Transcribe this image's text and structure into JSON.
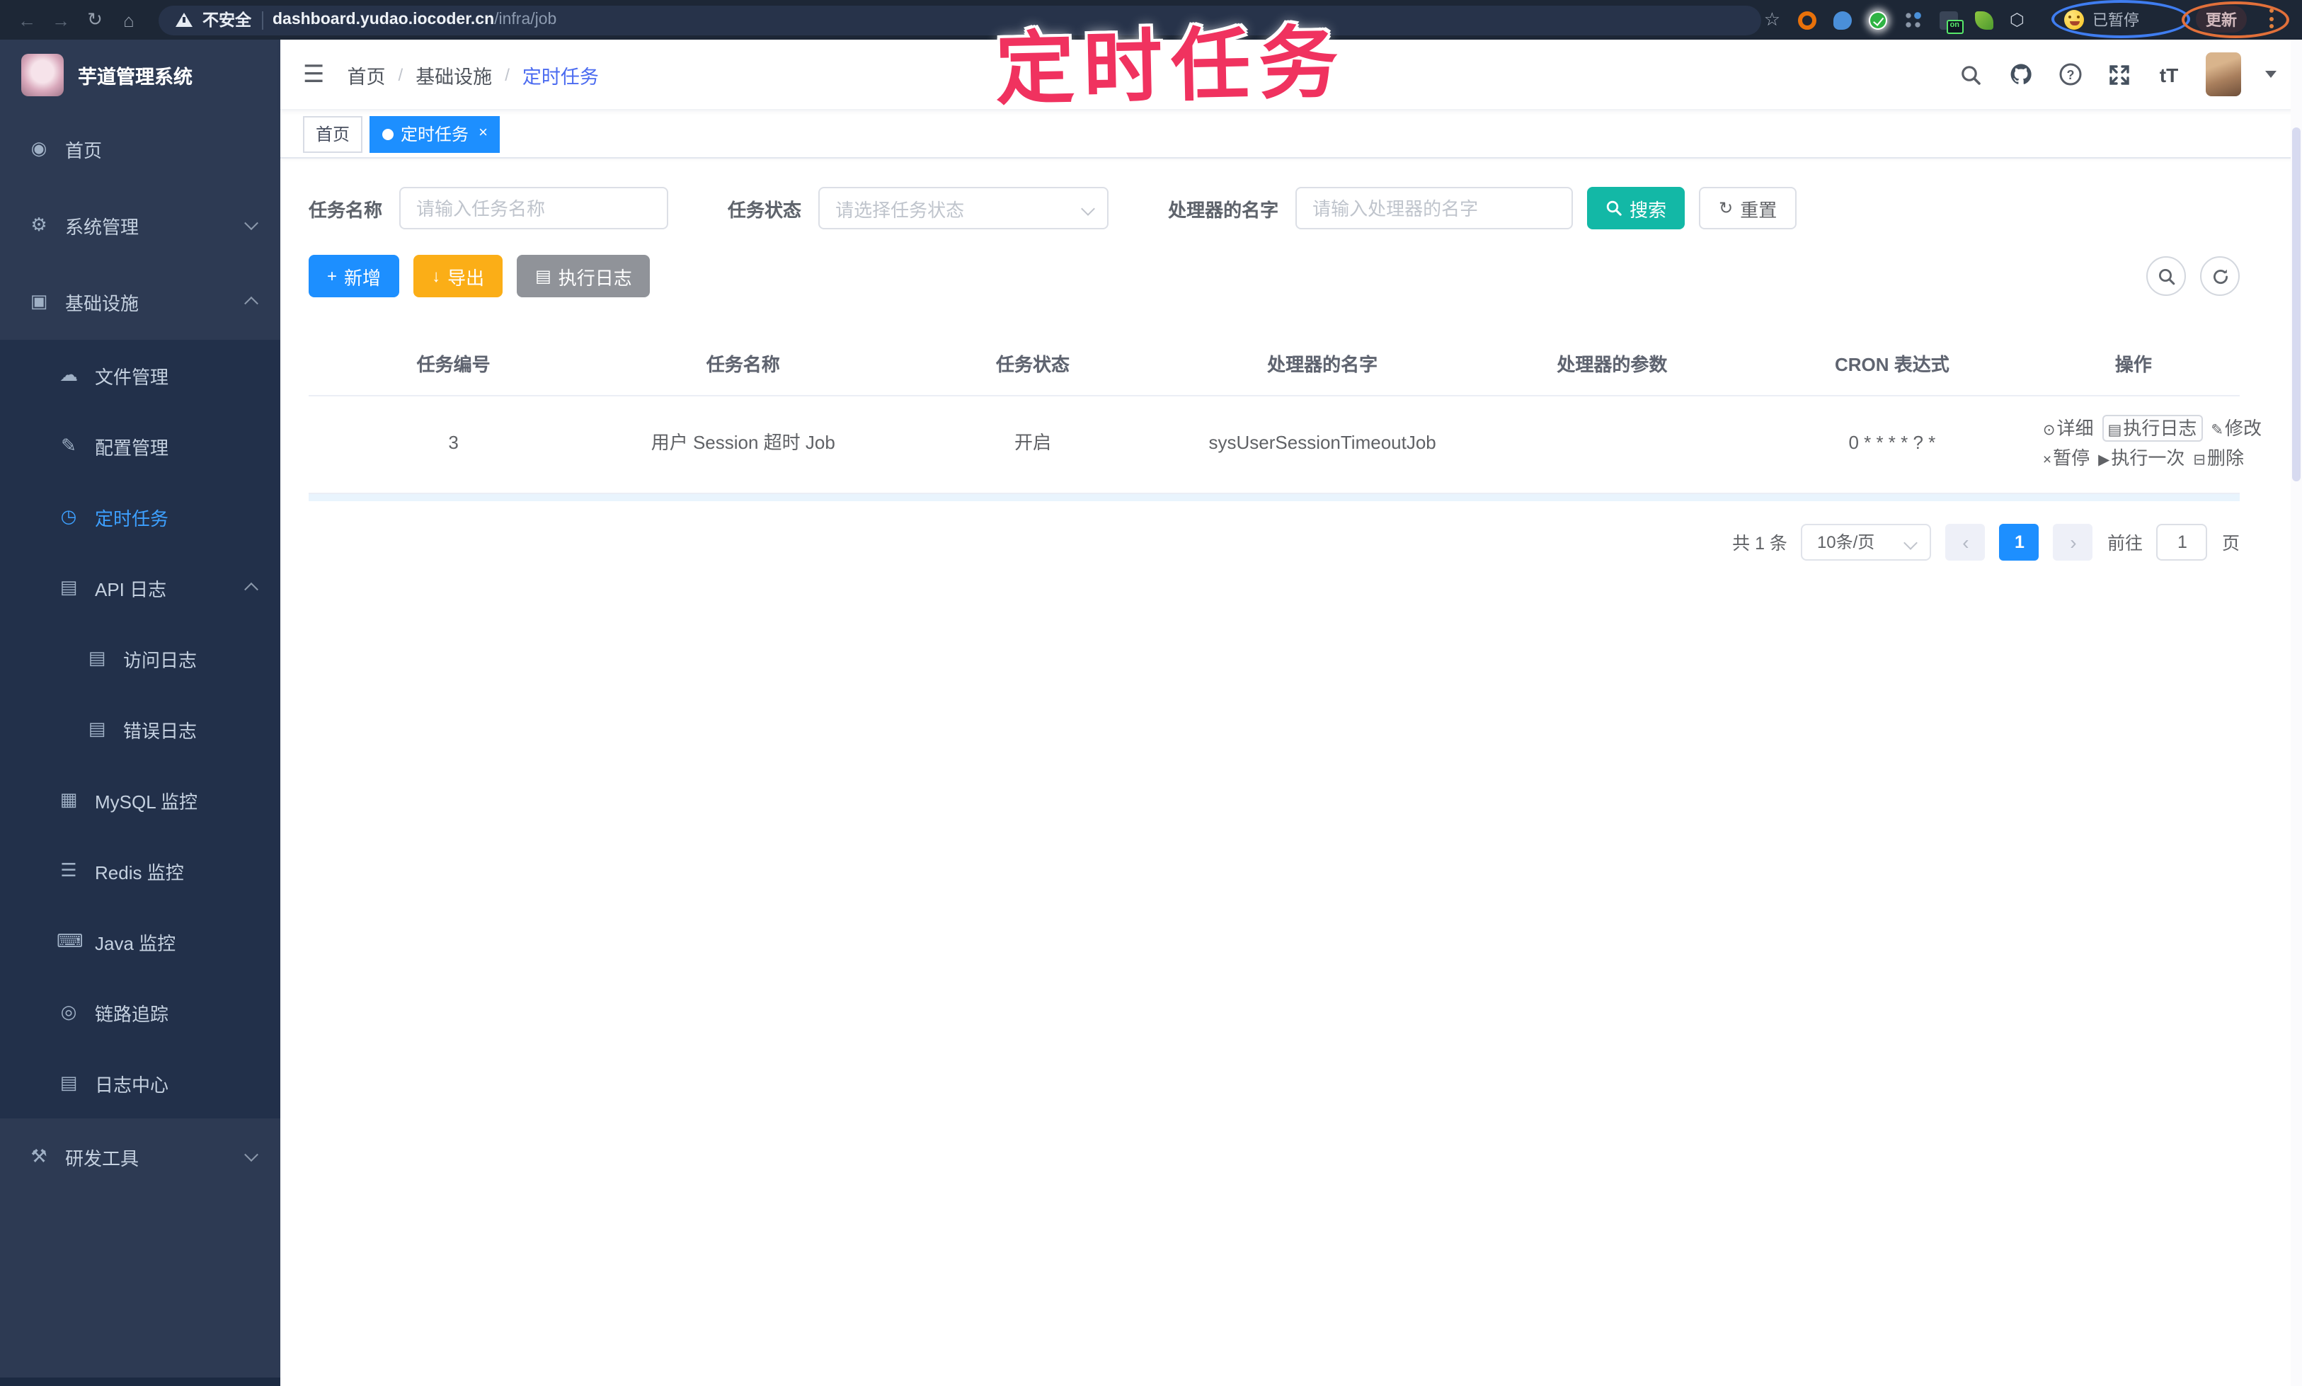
{
  "browser": {
    "back_icon": "←",
    "forward_icon": "→",
    "reload_icon": "↻",
    "home_icon": "⌂",
    "security_warning": "不安全",
    "url_host": "dashboard.yudao.iocoder.cn",
    "url_path": "/infra/job",
    "ext_on_badge": "on",
    "paused_badge": "已暂停",
    "update_button": "更新"
  },
  "annotation": {
    "title": "定时任务"
  },
  "sidebar": {
    "title": "芋道管理系统",
    "items": [
      {
        "icon": "◉",
        "label": "首页"
      },
      {
        "icon": "⚙",
        "label": "系统管理"
      },
      {
        "icon": "▣",
        "label": "基础设施"
      },
      {
        "icon": "☁",
        "label": "文件管理"
      },
      {
        "icon": "✎",
        "label": "配置管理"
      },
      {
        "icon": "◷",
        "label": "定时任务"
      },
      {
        "icon": "▤",
        "label": "API 日志"
      },
      {
        "icon": "▤",
        "label": "访问日志"
      },
      {
        "icon": "▤",
        "label": "错误日志"
      },
      {
        "icon": "▦",
        "label": "MySQL 监控"
      },
      {
        "icon": "☰",
        "label": "Redis 监控"
      },
      {
        "icon": "⌨",
        "label": "Java 监控"
      },
      {
        "icon": "◎",
        "label": "链路追踪"
      },
      {
        "icon": "▤",
        "label": "日志中心"
      },
      {
        "icon": "⚒",
        "label": "研发工具"
      }
    ]
  },
  "navbar": {
    "hamburger_icon": "☰",
    "breadcrumb": {
      "home": "首页",
      "separator": "/",
      "section": "基础设施",
      "current": "定时任务"
    },
    "text_size_icon": "tT"
  },
  "tags": {
    "home": "首页",
    "current": "定时任务",
    "close": "×"
  },
  "filters": {
    "name_label": "任务名称",
    "name_placeholder": "请输入任务名称",
    "status_label": "任务状态",
    "status_placeholder": "请选择任务状态",
    "handler_label": "处理器的名字",
    "handler_placeholder": "请输入处理器的名字",
    "search_label": "搜索",
    "reset_icon": "↻",
    "reset_label": "重置"
  },
  "toolbar": {
    "add_icon": "+",
    "add_label": "新增",
    "export_icon": "↓",
    "export_label": "导出",
    "log_icon": "▤",
    "log_label": "执行日志"
  },
  "table": {
    "headers": [
      "任务编号",
      "任务名称",
      "任务状态",
      "处理器的名字",
      "处理器的参数",
      "CRON 表达式",
      "操作"
    ],
    "row": {
      "id": "3",
      "name": "用户 Session 超时 Job",
      "status": "开启",
      "handler": "sysUserSessionTimeoutJob",
      "params": "",
      "cron": "0 * * * * ? *"
    },
    "actions": {
      "detail_icon": "⊙",
      "detail": "详细",
      "log_icon": "▤",
      "log": "执行日志",
      "edit_icon": "✎",
      "edit": "修改",
      "pause_icon": "×",
      "pause": "暂停",
      "run_icon": "▶",
      "run": "执行一次",
      "delete_icon": "⊟",
      "delete": "删除"
    }
  },
  "pagination": {
    "total": "共 1 条",
    "page_size": "10条/页",
    "prev_icon": "‹",
    "page": "1",
    "next_icon": "›",
    "goto_label": "前往",
    "goto_value": "1",
    "unit_label": "页"
  },
  "colors": {
    "primary_blue": "#1d8fff",
    "search_teal": "#13b8a6",
    "export_amber": "#fbae17",
    "info_gray": "#909399",
    "sidebar_bg": "#2d3a53",
    "submenu_bg": "#22304a",
    "annotation_pink": "#f0325f",
    "link_blue": "#2b8cff",
    "breadcrumb_current": "#4b6bf0"
  }
}
